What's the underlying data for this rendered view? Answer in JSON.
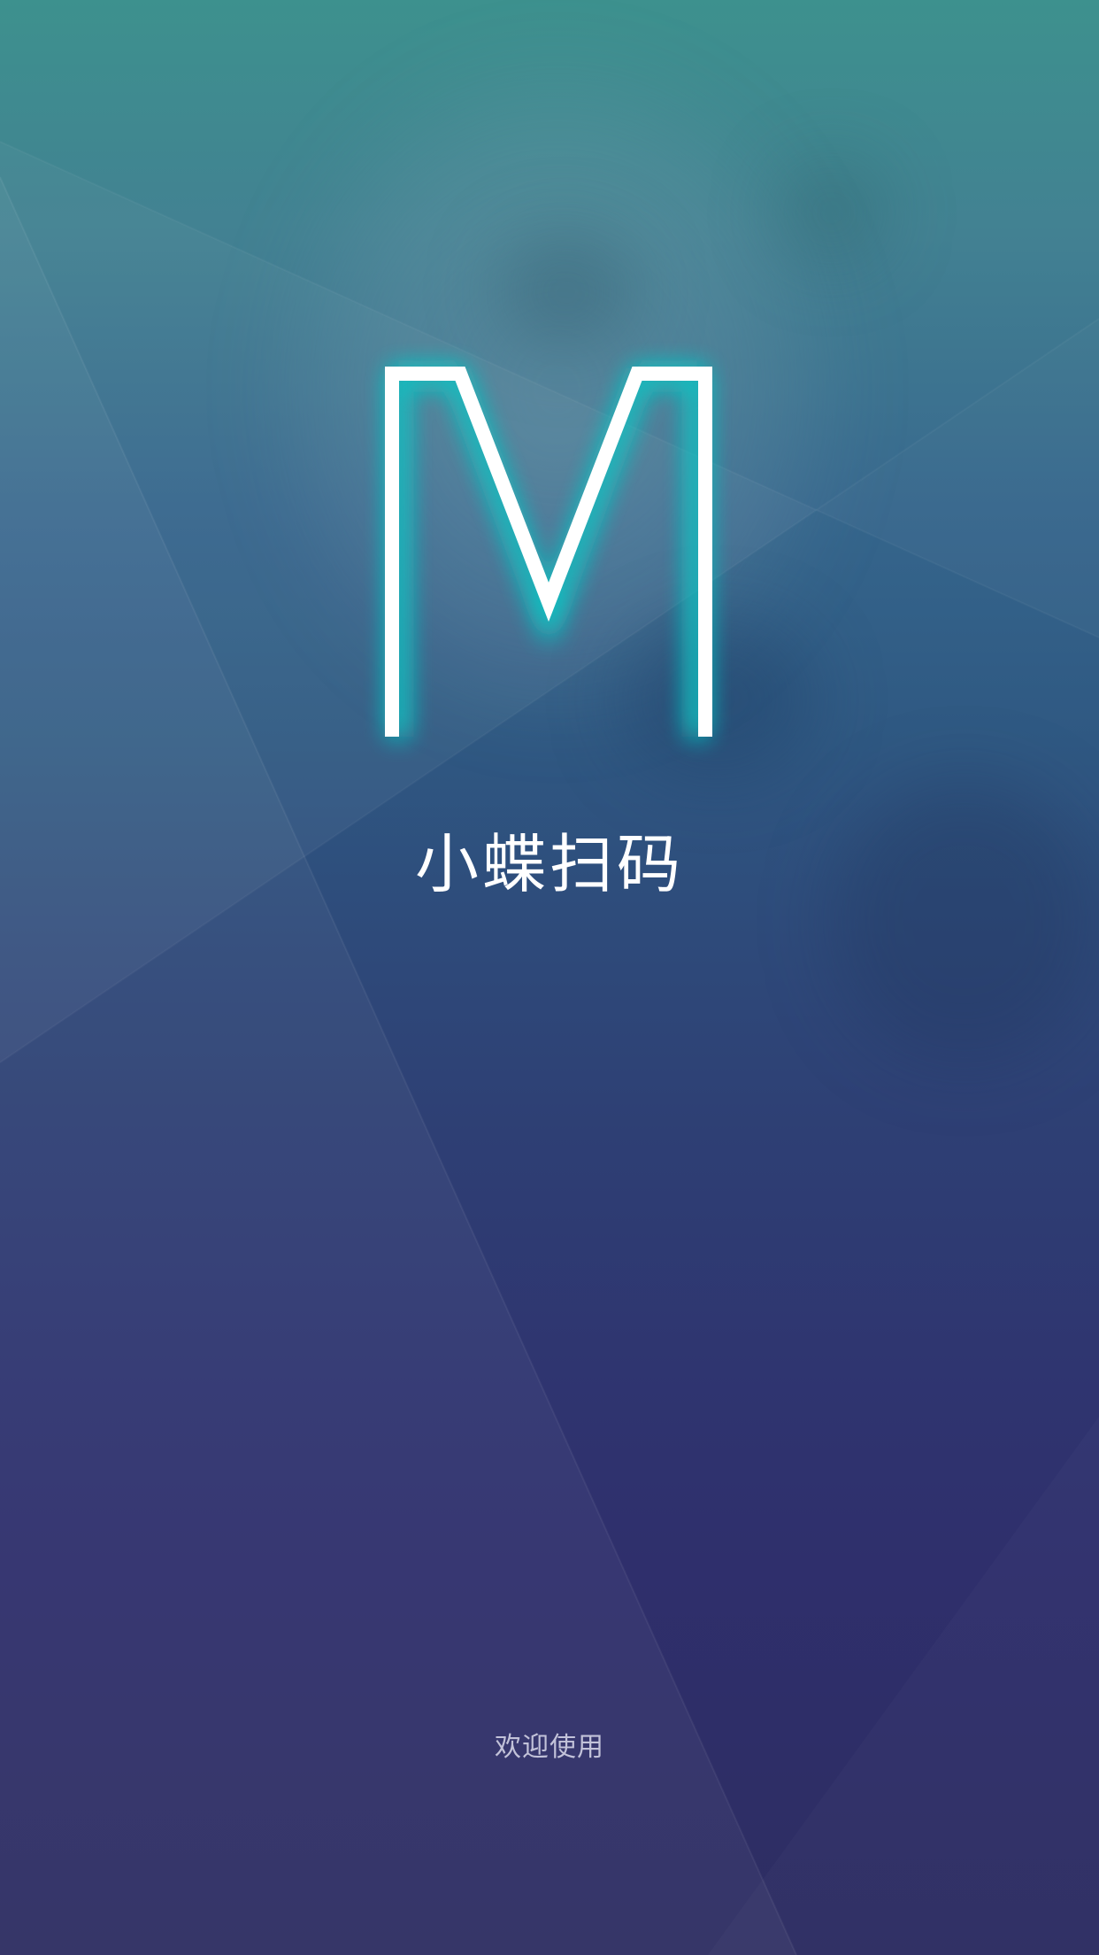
{
  "splash": {
    "logo_letter": "M",
    "app_name": "小蝶扫码",
    "welcome_text": "欢迎使用"
  },
  "theme": {
    "logo_glow_color": "#19c2c2",
    "logo_stroke_color": "#ffffff",
    "background_top_color": "#3a8f8c",
    "background_bottom_color": "#2d2d62"
  }
}
